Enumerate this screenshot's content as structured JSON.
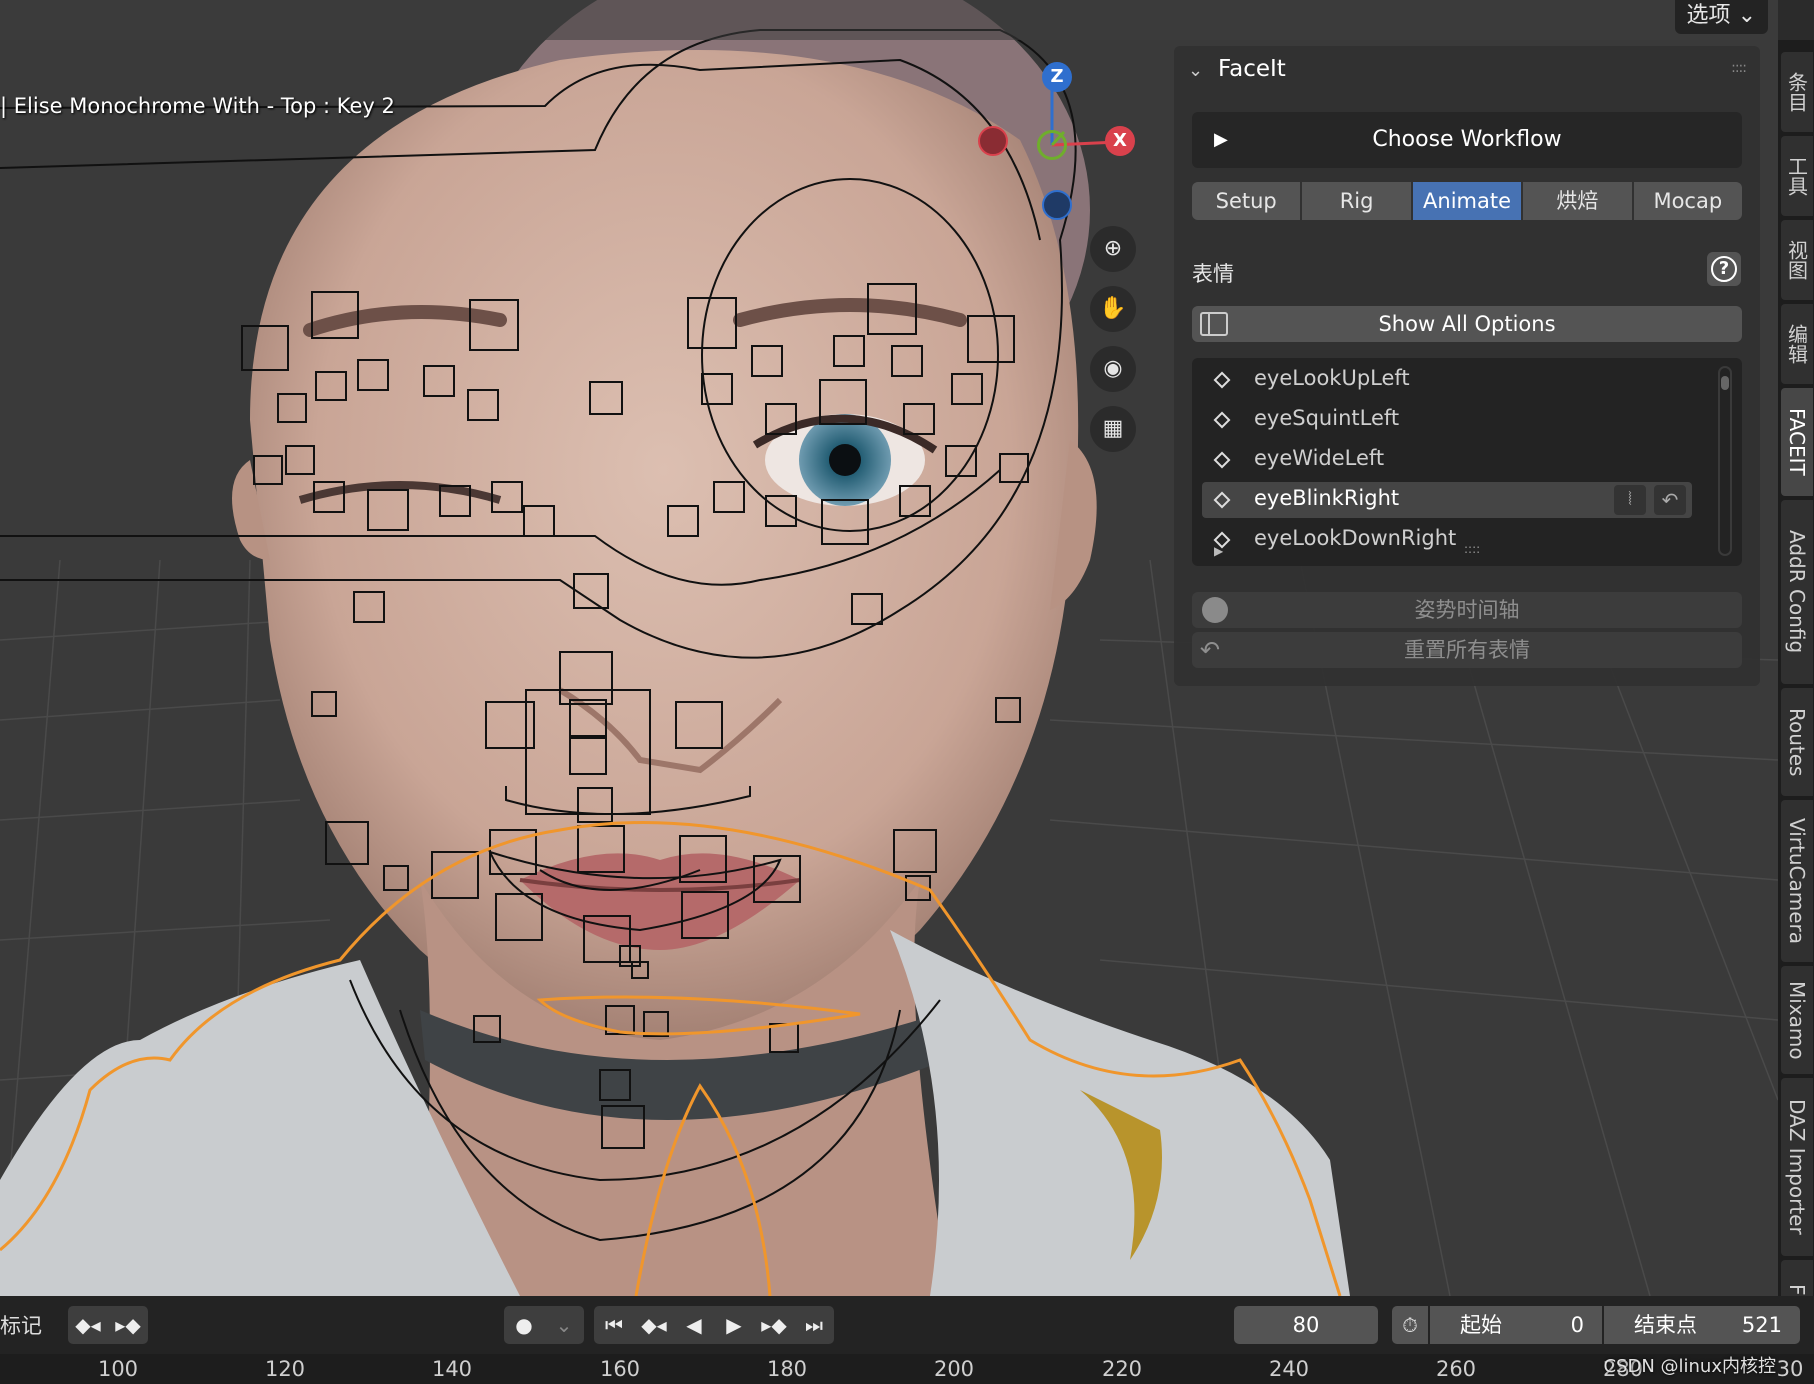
{
  "viewport": {
    "options_label": "选项",
    "object_label": "| Elise Monochrome With - Top : Key 2",
    "gizmo": {
      "z": "Z",
      "x": "X"
    }
  },
  "sidebar_tabs": [
    "条目",
    "工具",
    "视图",
    "编辑",
    "FACEIT",
    "AddR Config",
    "Routes",
    "VirtuCamera",
    "Mixamo",
    "DAZ Importer",
    "F"
  ],
  "panel": {
    "title": "FaceIt",
    "workflow_button": "Choose Workflow",
    "workflow_tabs": [
      "Setup",
      "Rig",
      "Animate",
      "烘焙",
      "Mocap"
    ],
    "active_tab": "Animate",
    "section_label": "表情",
    "help_icon": "?",
    "show_all_button": "Show All Options",
    "expressions": [
      "eyeLookUpLeft",
      "eyeSquintLeft",
      "eyeWideLeft",
      "eyeBlinkRight",
      "eyeLookDownRight"
    ],
    "selected_expression": "eyeBlinkRight",
    "pose_timeline_button": "姿势时间轴",
    "reset_button": "重置所有表情",
    "accent_color": "#4772b3"
  },
  "timeline": {
    "markers_label": "标记",
    "current_frame": "80",
    "start_label": "起始",
    "start_value": "0",
    "end_label": "结束点",
    "end_value": "521",
    "ruler_ticks": [
      "100",
      "120",
      "140",
      "160",
      "180",
      "200",
      "220",
      "240",
      "260",
      "280",
      "30"
    ]
  },
  "watermark": "CSDN @linux内核控"
}
